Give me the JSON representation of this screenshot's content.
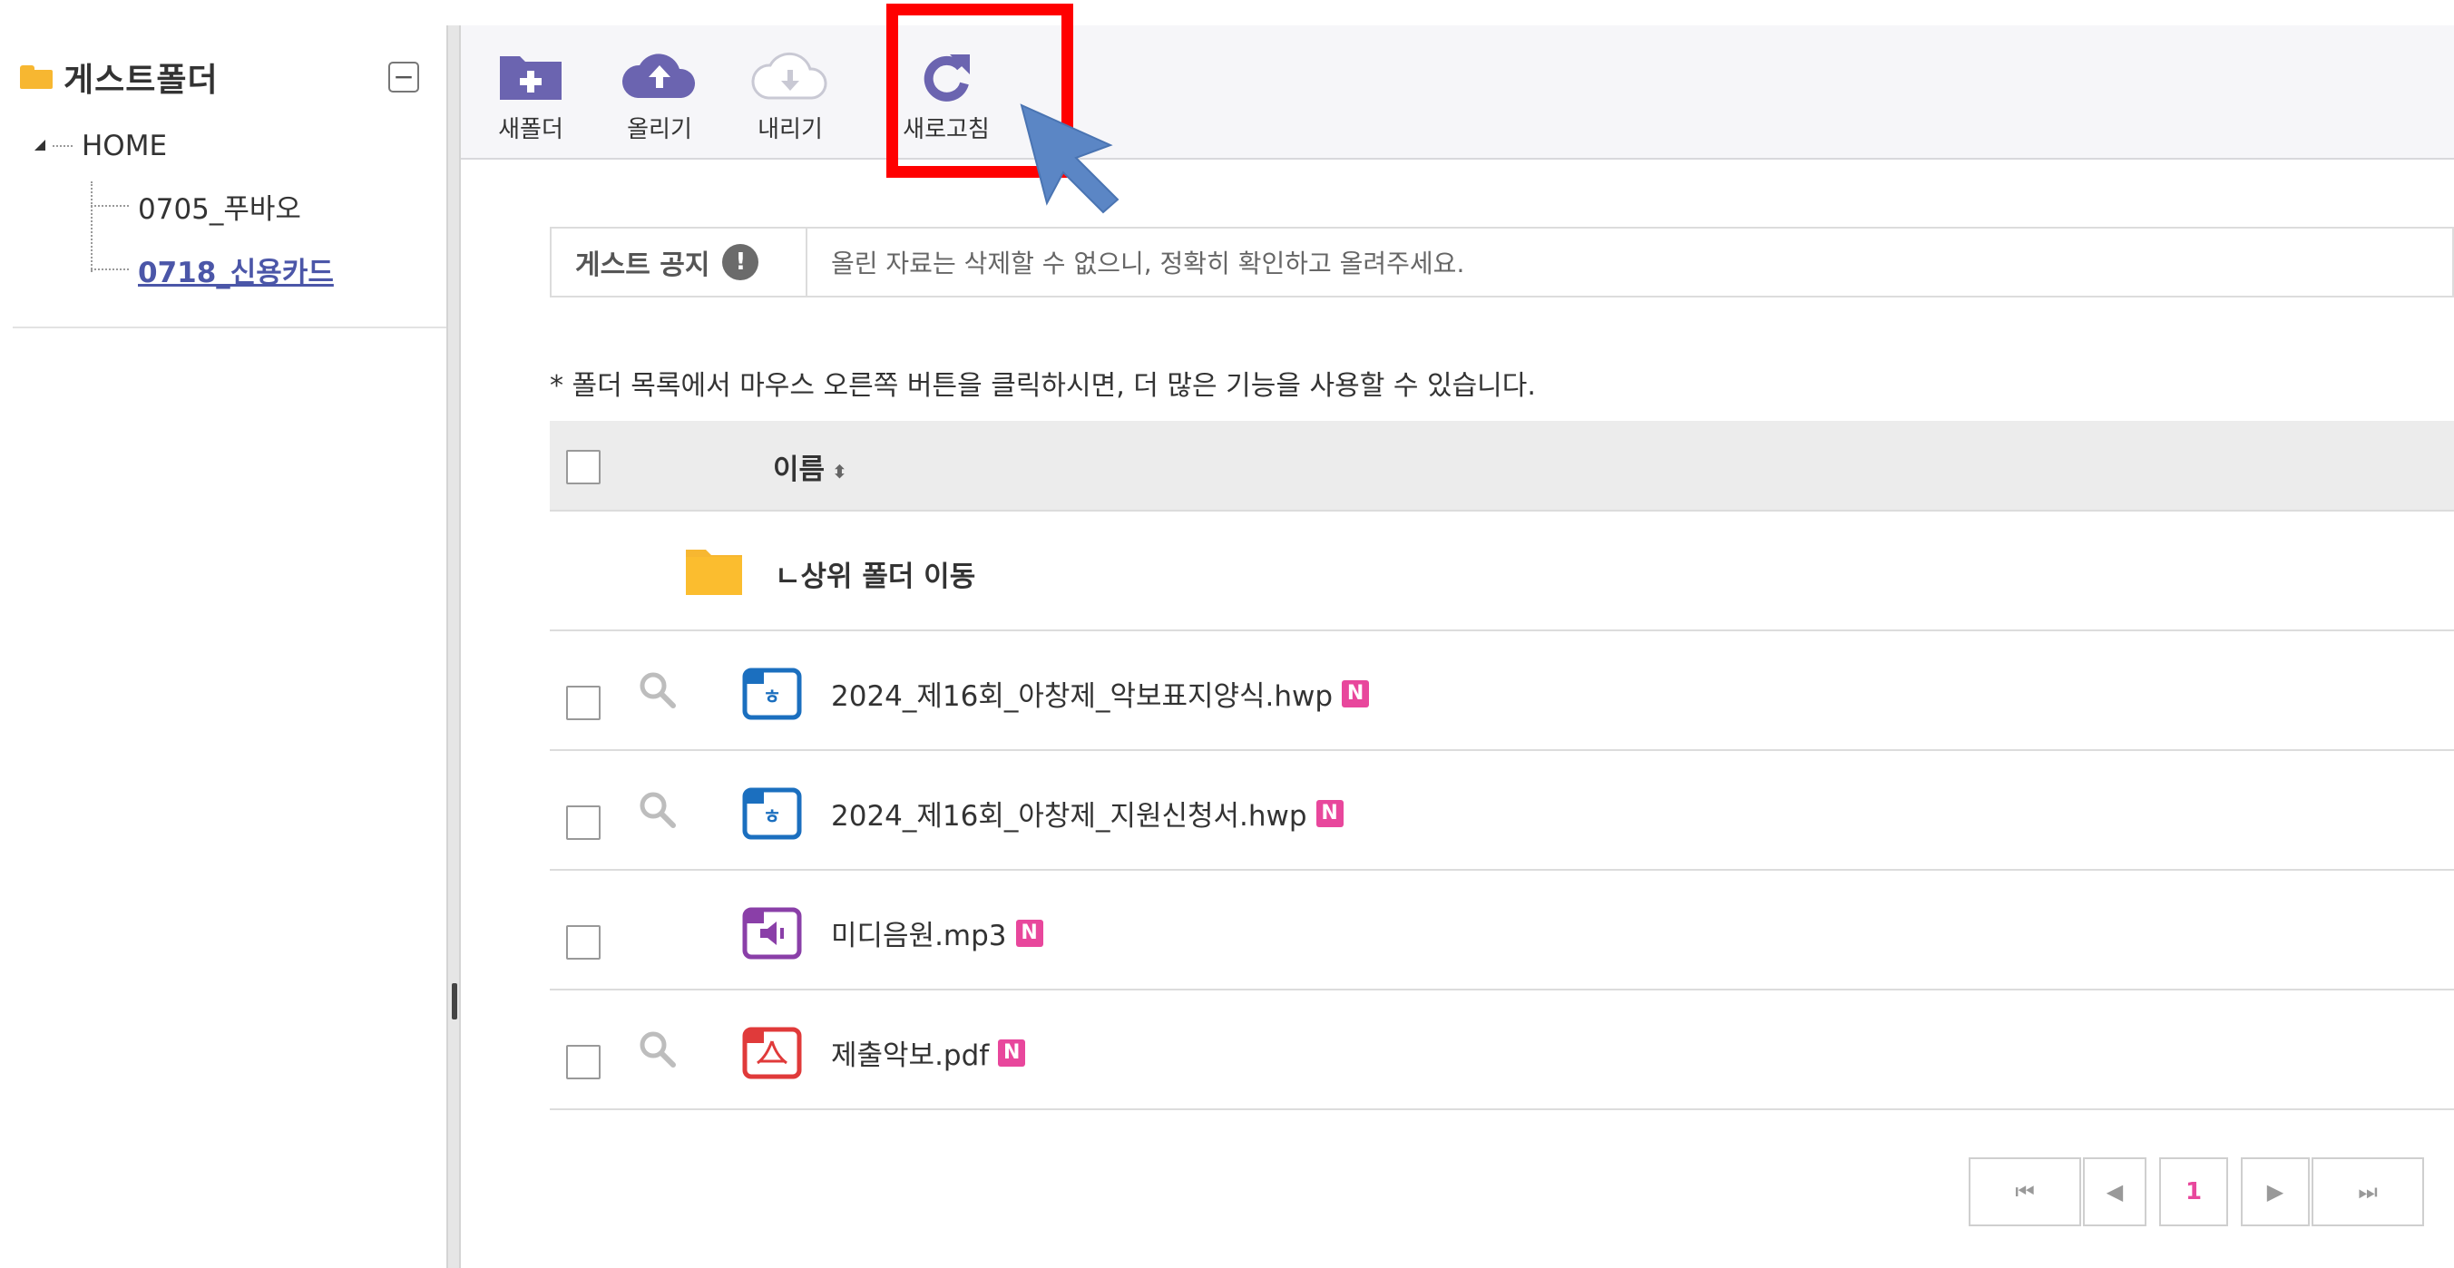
{
  "sidebar": {
    "title": "게스트폴더",
    "collapse_symbol": "−",
    "tree": [
      {
        "label": "HOME"
      },
      {
        "label": "0705_푸바오"
      },
      {
        "label": "0718_신용카드",
        "selected": true
      }
    ]
  },
  "toolbar": {
    "buttons": [
      {
        "label": "새폴더",
        "icon": "new-folder-icon"
      },
      {
        "label": "올리기",
        "icon": "upload-cloud-icon"
      },
      {
        "label": "내리기",
        "icon": "download-cloud-icon"
      },
      {
        "label": "새로고침",
        "icon": "refresh-icon"
      }
    ]
  },
  "notice": {
    "title": "게스트 공지",
    "badge": "!",
    "text": "올린 자료는 삭제할 수 없으니, 정확히 확인하고 올려주세요."
  },
  "hint": "* 폴더 목록에서 마우스 오른쪽 버튼을 클릭하시면, 더 많은 기능을 사용할 수 있습니다.",
  "table": {
    "header_name": "이름",
    "sort_symbol": "⬍",
    "up_folder": "ㄴ상위 폴더 이동",
    "new_badge": "N",
    "files": [
      {
        "name": "2024_제16회_아창제_악보표지양식.hwp",
        "type": "hwp",
        "preview": true,
        "is_new": true
      },
      {
        "name": "2024_제16회_아창제_지원신청서.hwp",
        "type": "hwp",
        "preview": true,
        "is_new": true
      },
      {
        "name": "미디음원.mp3",
        "type": "mp3",
        "preview": false,
        "is_new": true
      },
      {
        "name": "제출악보.pdf",
        "type": "pdf",
        "preview": true,
        "is_new": true
      }
    ]
  },
  "pager": {
    "first": "⏮",
    "prev": "◀",
    "current": "1",
    "next": "▶",
    "last": "⏭"
  },
  "colors": {
    "accent": "#6b64b0",
    "folder": "#f7b731",
    "hwp_blue": "#1b6fbf",
    "mp3_purple": "#8a3fa8",
    "pdf_red": "#e03a3a",
    "new_badge": "#e8479c",
    "highlight": "#ff0000",
    "cursor": "#5b86c5"
  }
}
